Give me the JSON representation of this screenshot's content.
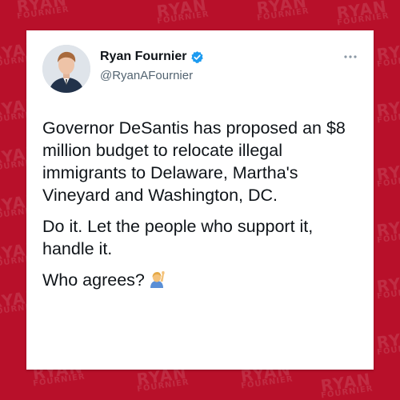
{
  "background": {
    "color": "#b8102a",
    "watermark_line1": "RYAN",
    "watermark_line2": "FOURNIER"
  },
  "tweet": {
    "author": {
      "display_name": "Ryan Fournier",
      "handle": "@RyanAFournier",
      "verified": true,
      "verified_color": "#1d9bf0",
      "avatar_icon": "profile-photo"
    },
    "more_icon": "more-horizontal-icon",
    "paragraphs": [
      "Governor DeSantis has proposed an $8 million budget to relocate illegal immigrants to Delaware, Martha's Vineyard and Washington, DC.",
      "Do it. Let the people who support it, handle it.",
      "Who agrees?"
    ],
    "trailing_emoji": "raising-hand-emoji"
  }
}
